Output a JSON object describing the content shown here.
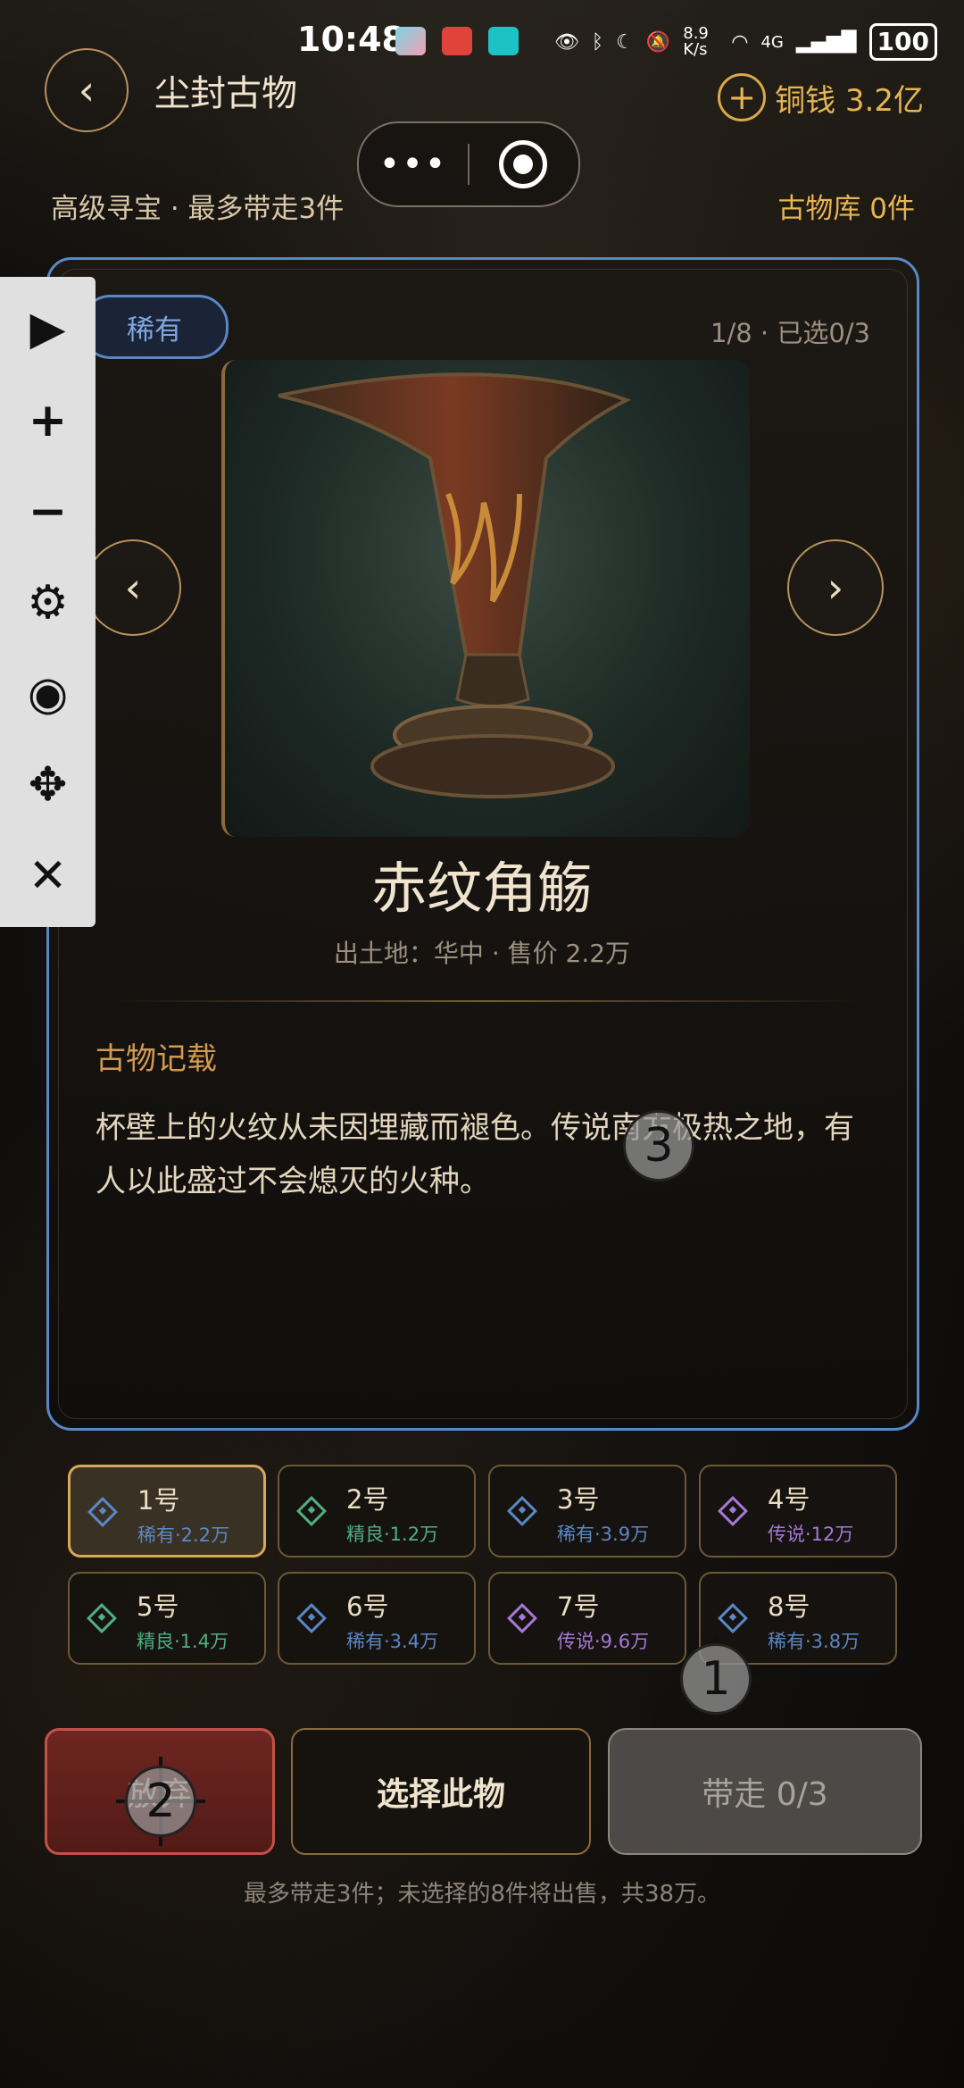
{
  "status_bar": {
    "time": "10:48",
    "net_speed": "8.9 K/s",
    "signal": "4G",
    "battery": "100"
  },
  "header": {
    "back_glyph": "‹",
    "title": "尘封古物",
    "coin_plus": "+",
    "coin_label": "铜钱 3.2亿",
    "subinfo": "高级寻宝 · 最多带走3件",
    "vault": "古物库 0件"
  },
  "miniprogram": {
    "more": "•••"
  },
  "card": {
    "rarity": "稀有",
    "counter": "1/8 · 已选0/3",
    "prev_glyph": "‹",
    "next_glyph": "›",
    "name": "赤纹角觞",
    "meta": "出土地：华中 · 售价 2.2万",
    "section_title": "古物记载",
    "description": "杯壁上的火纹从未因埋藏而褪色。传说南方极热之地，有人以此盛过不会熄灭的火种。"
  },
  "toolbar": {
    "play": "▶",
    "plus": "+",
    "minus": "−",
    "settings": "⚙",
    "hide": "◉",
    "move": "✥",
    "close": "✕"
  },
  "items": [
    {
      "name": "1号",
      "sub": "稀有·2.2万",
      "color": "#5a87c6",
      "selected": true
    },
    {
      "name": "2号",
      "sub": "精良·1.2万",
      "color": "#4fb081",
      "selected": false
    },
    {
      "name": "3号",
      "sub": "稀有·3.9万",
      "color": "#5a87c6",
      "selected": false
    },
    {
      "name": "4号",
      "sub": "传说·12万",
      "color": "#a878d8",
      "selected": false
    },
    {
      "name": "5号",
      "sub": "精良·1.4万",
      "color": "#4fb081",
      "selected": false
    },
    {
      "name": "6号",
      "sub": "稀有·3.4万",
      "color": "#5a87c6",
      "selected": false
    },
    {
      "name": "7号",
      "sub": "传说·9.6万",
      "color": "#a878d8",
      "selected": false
    },
    {
      "name": "8号",
      "sub": "稀有·3.8万",
      "color": "#5a87c6",
      "selected": false
    }
  ],
  "actions": {
    "abandon": "放弃",
    "select": "选择此物",
    "take": "带走 0/3"
  },
  "footer_note": "最多带走3件；未选择的8件将出售，共38万。",
  "markers": [
    "1",
    "2",
    "3"
  ]
}
